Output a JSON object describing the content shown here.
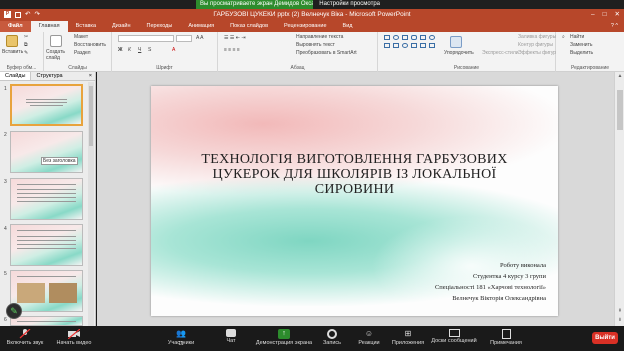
{
  "zoom_share": {
    "banner": "Вы просматриваете экран Демидов Оксана",
    "options": "Настройки просмотра"
  },
  "window": {
    "title": "ГАРБУЗОВІ ЦУКЕКИ pptx (2) Велнечук Віка - Microsoft PowerPoint"
  },
  "ribbon_tabs": [
    "Файл",
    "Главная",
    "Вставка",
    "Дизайн",
    "Переходы",
    "Анимация",
    "Показ слайдов",
    "Рецензирование",
    "Вид"
  ],
  "ribbon": {
    "paste": "Вставить",
    "new_slide": "Создать слайд",
    "layout": "Макет",
    "reset": "Восстановить",
    "section": "Раздел",
    "clipboard": "Буфер обм...",
    "slides": "Слайды",
    "font": "Шрифт",
    "paragraph": "Абзац",
    "text_direction": "Направление текста",
    "align_text": "Выровнять текст",
    "smartart": "Преобразовать в SmartArt",
    "arrange": "Упорядочить",
    "quick_styles": "Экспресс-стили",
    "shape_fill": "Заливка фигуры",
    "shape_outline": "Контур фигуры",
    "shape_effects": "Эффекты фигур",
    "drawing": "Рисование",
    "find": "Найти",
    "replace": "Заменить",
    "select": "Выделить",
    "editing": "Редактирование"
  },
  "left_pane": {
    "tab_slides": "Слайды",
    "tab_outline": "Структура",
    "close": "×",
    "slide_numbers": [
      "1",
      "2",
      "3",
      "4",
      "5",
      "6"
    ],
    "thumb2_label": "Без заголовка"
  },
  "slide": {
    "title": "ТЕХНОЛОГІЯ ВИГОТОВЛЕННЯ ГАРБУЗОВИХ ЦУКЕРОК ДЛЯ ШКОЛЯРІВ ІЗ ЛОКАЛЬНОЇ СИРОВИНИ",
    "sub_lines": [
      "Роботу виконала",
      "Студентка 4 курсу 3 групи",
      "Спеціальності 181 «Харчові технології»",
      "Велнечук Вікторія Олександрівна"
    ]
  },
  "zoom_bar": {
    "audio": "Включить звук",
    "video": "Начать видео",
    "participants": "Участники",
    "participants_count": "11",
    "chat": "Чат",
    "share": "Демонстрация экрана",
    "record": "Запись",
    "reactions": "Реакции",
    "apps": "Приложения",
    "whiteboards": "Доски сообщений",
    "notes": "Примечания",
    "leave": "Выйти"
  },
  "colors": {
    "ppt_accent": "#b7472a",
    "zoom_green": "#2d8c2d",
    "leave_red": "#d93025"
  }
}
